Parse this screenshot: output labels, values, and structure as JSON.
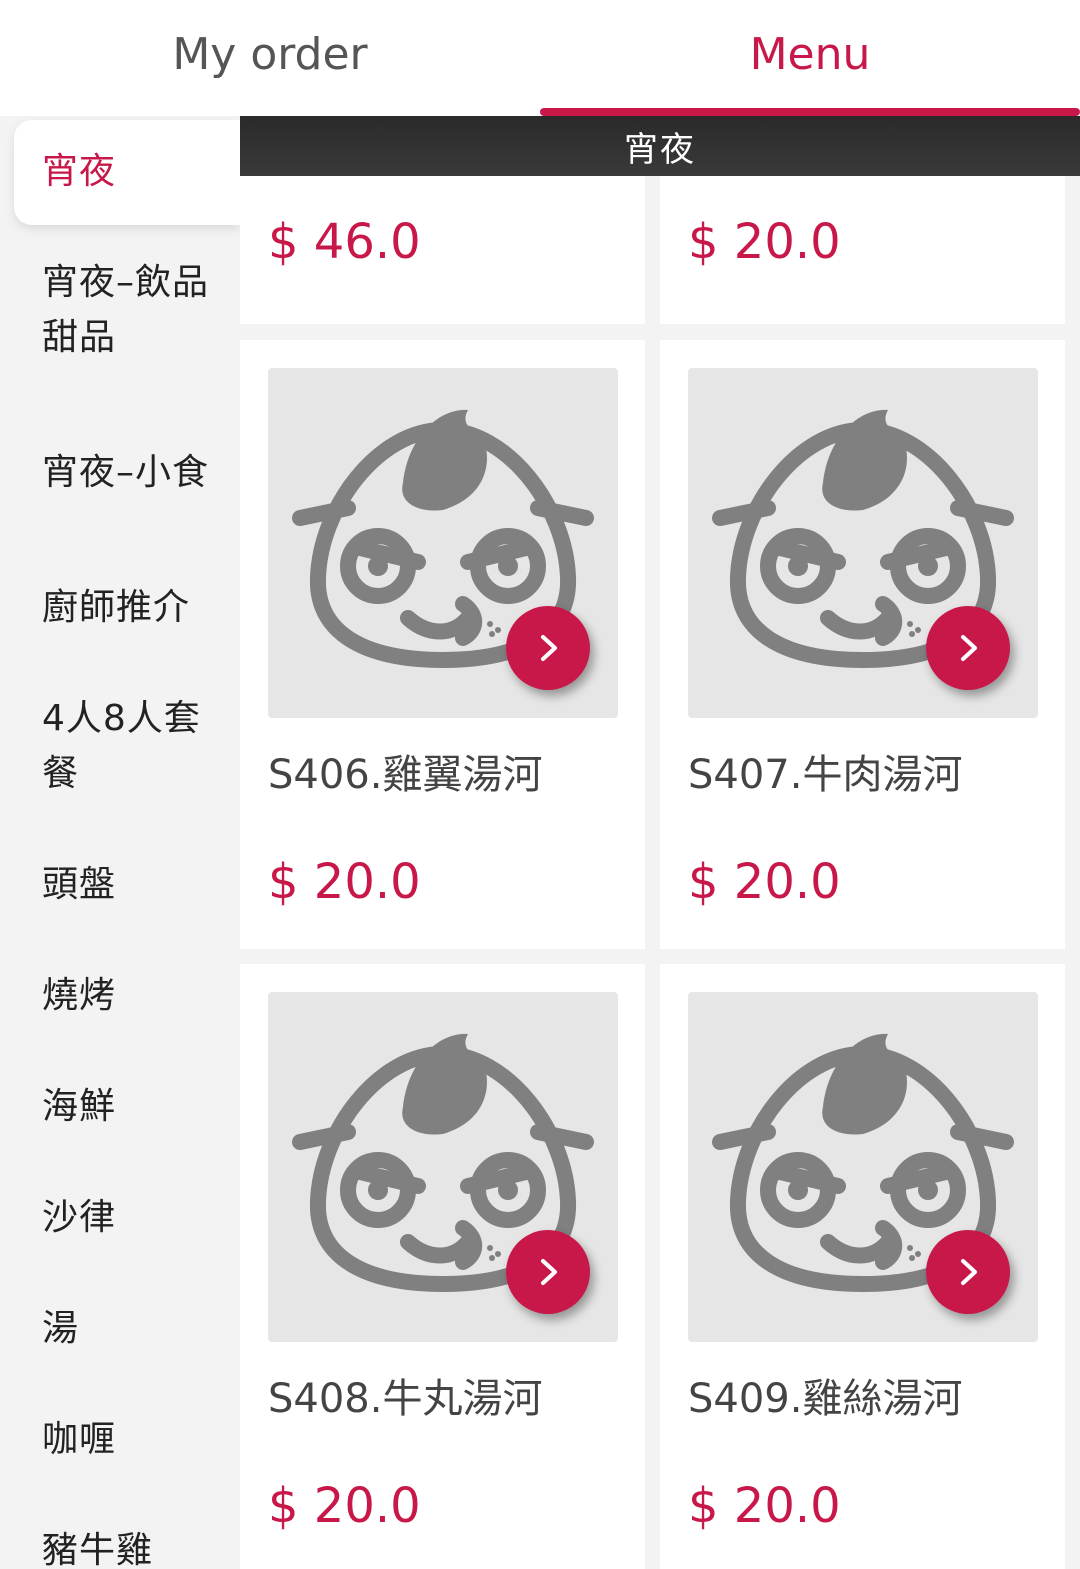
{
  "tabs": {
    "my_order": "My order",
    "menu": "Menu",
    "active": "menu"
  },
  "sidebar": {
    "items": [
      {
        "label": "宵夜",
        "active": true
      },
      {
        "label": "宵夜–飲品甜品"
      },
      {
        "label": "宵夜–小食"
      },
      {
        "label": "廚師推介"
      },
      {
        "label": "4人8人套餐"
      },
      {
        "label": "頭盤"
      },
      {
        "label": "燒烤"
      },
      {
        "label": "海鮮"
      },
      {
        "label": "沙律"
      },
      {
        "label": "湯"
      },
      {
        "label": "咖喱"
      },
      {
        "label": "豬牛雞"
      }
    ]
  },
  "section": {
    "title": "宵夜"
  },
  "items": [
    {
      "price": "$ 46.0"
    },
    {
      "price": "$ 20.0"
    },
    {
      "name": "S406.雞翼湯河",
      "price": "$ 20.0"
    },
    {
      "name": "S407.牛肉湯河",
      "price": "$ 20.0"
    },
    {
      "name": "S408.牛丸湯河",
      "price": "$ 20.0"
    },
    {
      "name": "S409.雞絲湯河",
      "price": "$ 20.0"
    }
  ],
  "colors": {
    "accent": "#c8184a",
    "header_bg": "#333333",
    "placeholder_bg": "#e6e6e6",
    "mascot": "#808080"
  },
  "icons": {
    "placeholder": "mascot-placeholder-icon",
    "item_action": "chevron-right-icon"
  }
}
